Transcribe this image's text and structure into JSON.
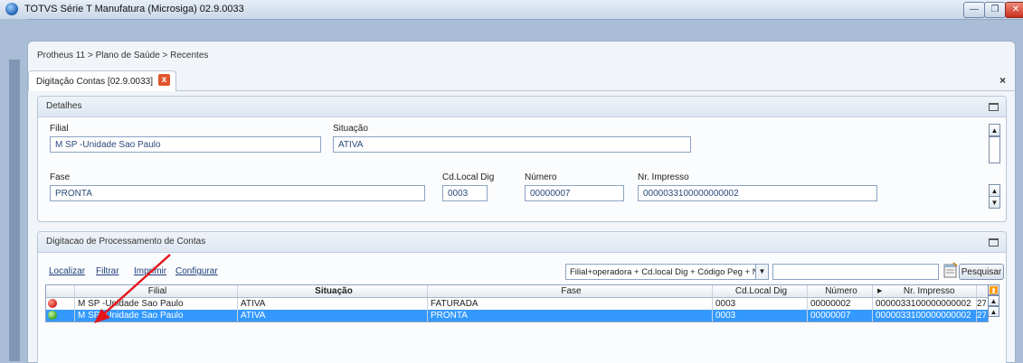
{
  "window": {
    "title": "TOTVS Série T Manufatura (Microsiga) 02.9.0033",
    "min_label": "—",
    "max_label": "❐",
    "close_label": "✕"
  },
  "breadcrumb": "Protheus 11 > Plano de Saúde > Recentes",
  "tab": {
    "label": "Digitação Contas [02.9.0033]",
    "close": "x"
  },
  "panel_close": "×",
  "details": {
    "title": "Detalhes",
    "fields": {
      "filial": {
        "label": "Filial",
        "value": "M SP   -Unidade Sao Paulo"
      },
      "situacao": {
        "label": "Situação",
        "value": "ATIVA"
      },
      "fase": {
        "label": "Fase",
        "value": "PRONTA"
      },
      "cd_local_dig": {
        "label": "Cd.Local Dig",
        "value": "0003"
      },
      "numero": {
        "label": "Número",
        "value": "00000007"
      },
      "nr_impresso": {
        "label": "Nr. Impresso",
        "value": "0000033100000000002"
      }
    }
  },
  "grid_section": {
    "title": "Digitacao de Processamento de Contas",
    "links": {
      "localizar": "Localizar",
      "filtrar": "Filtrar",
      "imprimir": "Imprimir",
      "configurar": "Configurar"
    },
    "sort_select": "Filial+operadora + Cd.local Dig + Código Peg + Nún",
    "search_button": "Pesquisar",
    "columns": [
      "Filial",
      "Situação",
      "Fase",
      "Cd.Local Dig",
      "Número",
      "Nr. Impresso"
    ],
    "rows": [
      {
        "status_color": "#d0211c",
        "filial": "M SP   -Unidade Sao Paulo",
        "situacao": "ATIVA",
        "fase": "FATURADA",
        "cd_local_dig": "0003",
        "numero": "00000002",
        "nr_impresso": "0000033100000000002",
        "extra": "27",
        "selected": false
      },
      {
        "status_color": "#3aa61c",
        "filial": "M SP   -Unidade Sao Paulo",
        "situacao": "ATIVA",
        "fase": "PRONTA",
        "cd_local_dig": "0003",
        "numero": "00000007",
        "nr_impresso": "0000033100000000002",
        "extra": "27",
        "selected": true
      }
    ]
  }
}
